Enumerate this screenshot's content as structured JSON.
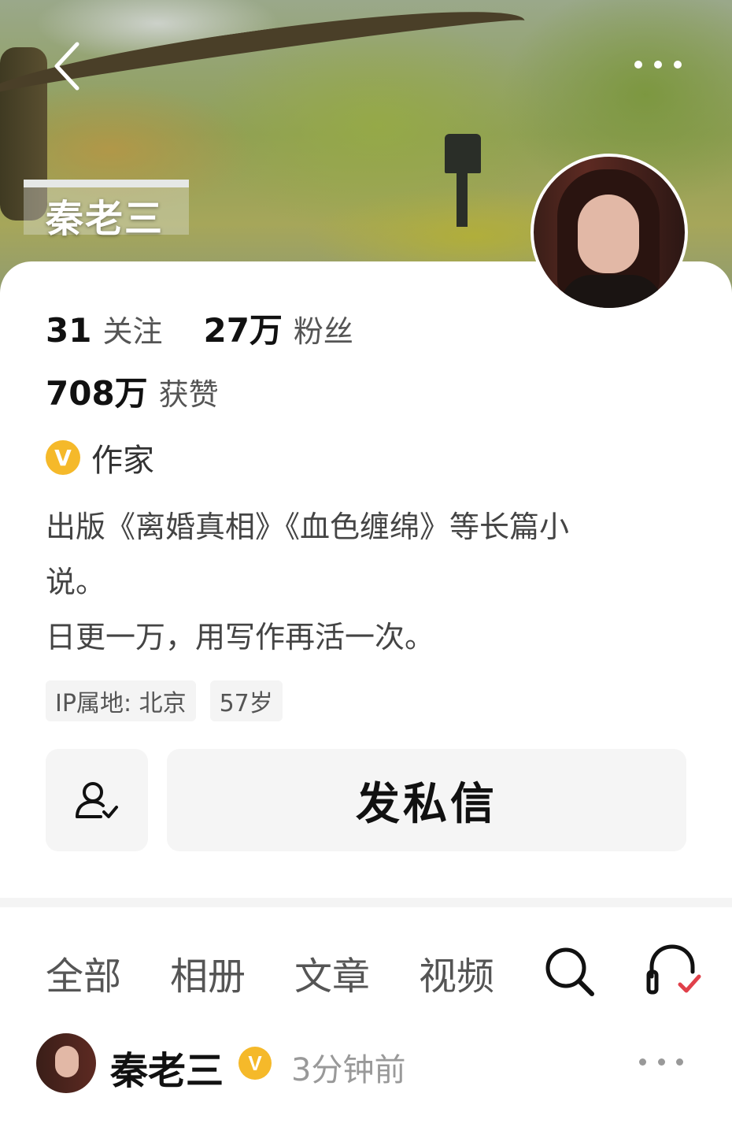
{
  "header": {
    "display_name": "秦老三",
    "back_icon": "back-chevron-icon",
    "more_icon": "more-dots-icon"
  },
  "profile": {
    "stats": [
      {
        "value": "31",
        "label": "关注"
      },
      {
        "value": "27万",
        "label": "粉丝"
      }
    ],
    "likes": {
      "value": "708万",
      "label": "获赞"
    },
    "verification": {
      "badge": "V",
      "label": "作家",
      "color": "#f5b92a"
    },
    "bio_lines": [
      "出版《离婚真相》《血色缠绵》等长篇小",
      "说。",
      "日更一万，用写作再活一次。"
    ],
    "tags": [
      "IP属地: 北京",
      "57岁"
    ],
    "follow_icon": "add-friend-icon",
    "message_button": "发私信"
  },
  "tabs": {
    "items": [
      "全部",
      "相册",
      "文章",
      "视频"
    ],
    "search_icon": "search-icon",
    "listen_icon": "headphones-check-icon"
  },
  "post": {
    "author": "秦老三",
    "badge": "V",
    "time": "3分钟前"
  }
}
